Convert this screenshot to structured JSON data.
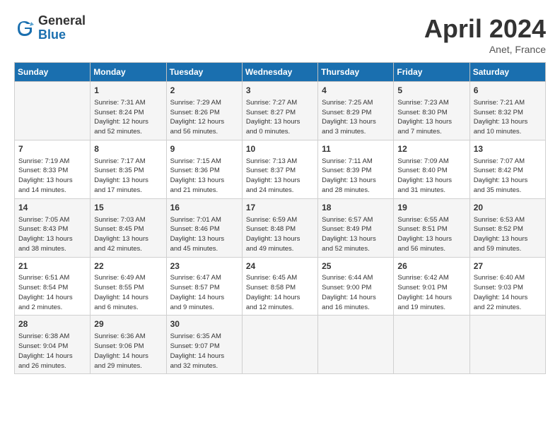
{
  "header": {
    "logo_general": "General",
    "logo_blue": "Blue",
    "title": "April 2024",
    "location": "Anet, France"
  },
  "days_of_week": [
    "Sunday",
    "Monday",
    "Tuesday",
    "Wednesday",
    "Thursday",
    "Friday",
    "Saturday"
  ],
  "weeks": [
    [
      {
        "day": "",
        "info": ""
      },
      {
        "day": "1",
        "info": "Sunrise: 7:31 AM\nSunset: 8:24 PM\nDaylight: 12 hours\nand 52 minutes."
      },
      {
        "day": "2",
        "info": "Sunrise: 7:29 AM\nSunset: 8:26 PM\nDaylight: 12 hours\nand 56 minutes."
      },
      {
        "day": "3",
        "info": "Sunrise: 7:27 AM\nSunset: 8:27 PM\nDaylight: 13 hours\nand 0 minutes."
      },
      {
        "day": "4",
        "info": "Sunrise: 7:25 AM\nSunset: 8:29 PM\nDaylight: 13 hours\nand 3 minutes."
      },
      {
        "day": "5",
        "info": "Sunrise: 7:23 AM\nSunset: 8:30 PM\nDaylight: 13 hours\nand 7 minutes."
      },
      {
        "day": "6",
        "info": "Sunrise: 7:21 AM\nSunset: 8:32 PM\nDaylight: 13 hours\nand 10 minutes."
      }
    ],
    [
      {
        "day": "7",
        "info": "Sunrise: 7:19 AM\nSunset: 8:33 PM\nDaylight: 13 hours\nand 14 minutes."
      },
      {
        "day": "8",
        "info": "Sunrise: 7:17 AM\nSunset: 8:35 PM\nDaylight: 13 hours\nand 17 minutes."
      },
      {
        "day": "9",
        "info": "Sunrise: 7:15 AM\nSunset: 8:36 PM\nDaylight: 13 hours\nand 21 minutes."
      },
      {
        "day": "10",
        "info": "Sunrise: 7:13 AM\nSunset: 8:37 PM\nDaylight: 13 hours\nand 24 minutes."
      },
      {
        "day": "11",
        "info": "Sunrise: 7:11 AM\nSunset: 8:39 PM\nDaylight: 13 hours\nand 28 minutes."
      },
      {
        "day": "12",
        "info": "Sunrise: 7:09 AM\nSunset: 8:40 PM\nDaylight: 13 hours\nand 31 minutes."
      },
      {
        "day": "13",
        "info": "Sunrise: 7:07 AM\nSunset: 8:42 PM\nDaylight: 13 hours\nand 35 minutes."
      }
    ],
    [
      {
        "day": "14",
        "info": "Sunrise: 7:05 AM\nSunset: 8:43 PM\nDaylight: 13 hours\nand 38 minutes."
      },
      {
        "day": "15",
        "info": "Sunrise: 7:03 AM\nSunset: 8:45 PM\nDaylight: 13 hours\nand 42 minutes."
      },
      {
        "day": "16",
        "info": "Sunrise: 7:01 AM\nSunset: 8:46 PM\nDaylight: 13 hours\nand 45 minutes."
      },
      {
        "day": "17",
        "info": "Sunrise: 6:59 AM\nSunset: 8:48 PM\nDaylight: 13 hours\nand 49 minutes."
      },
      {
        "day": "18",
        "info": "Sunrise: 6:57 AM\nSunset: 8:49 PM\nDaylight: 13 hours\nand 52 minutes."
      },
      {
        "day": "19",
        "info": "Sunrise: 6:55 AM\nSunset: 8:51 PM\nDaylight: 13 hours\nand 56 minutes."
      },
      {
        "day": "20",
        "info": "Sunrise: 6:53 AM\nSunset: 8:52 PM\nDaylight: 13 hours\nand 59 minutes."
      }
    ],
    [
      {
        "day": "21",
        "info": "Sunrise: 6:51 AM\nSunset: 8:54 PM\nDaylight: 14 hours\nand 2 minutes."
      },
      {
        "day": "22",
        "info": "Sunrise: 6:49 AM\nSunset: 8:55 PM\nDaylight: 14 hours\nand 6 minutes."
      },
      {
        "day": "23",
        "info": "Sunrise: 6:47 AM\nSunset: 8:57 PM\nDaylight: 14 hours\nand 9 minutes."
      },
      {
        "day": "24",
        "info": "Sunrise: 6:45 AM\nSunset: 8:58 PM\nDaylight: 14 hours\nand 12 minutes."
      },
      {
        "day": "25",
        "info": "Sunrise: 6:44 AM\nSunset: 9:00 PM\nDaylight: 14 hours\nand 16 minutes."
      },
      {
        "day": "26",
        "info": "Sunrise: 6:42 AM\nSunset: 9:01 PM\nDaylight: 14 hours\nand 19 minutes."
      },
      {
        "day": "27",
        "info": "Sunrise: 6:40 AM\nSunset: 9:03 PM\nDaylight: 14 hours\nand 22 minutes."
      }
    ],
    [
      {
        "day": "28",
        "info": "Sunrise: 6:38 AM\nSunset: 9:04 PM\nDaylight: 14 hours\nand 26 minutes."
      },
      {
        "day": "29",
        "info": "Sunrise: 6:36 AM\nSunset: 9:06 PM\nDaylight: 14 hours\nand 29 minutes."
      },
      {
        "day": "30",
        "info": "Sunrise: 6:35 AM\nSunset: 9:07 PM\nDaylight: 14 hours\nand 32 minutes."
      },
      {
        "day": "",
        "info": ""
      },
      {
        "day": "",
        "info": ""
      },
      {
        "day": "",
        "info": ""
      },
      {
        "day": "",
        "info": ""
      }
    ]
  ]
}
